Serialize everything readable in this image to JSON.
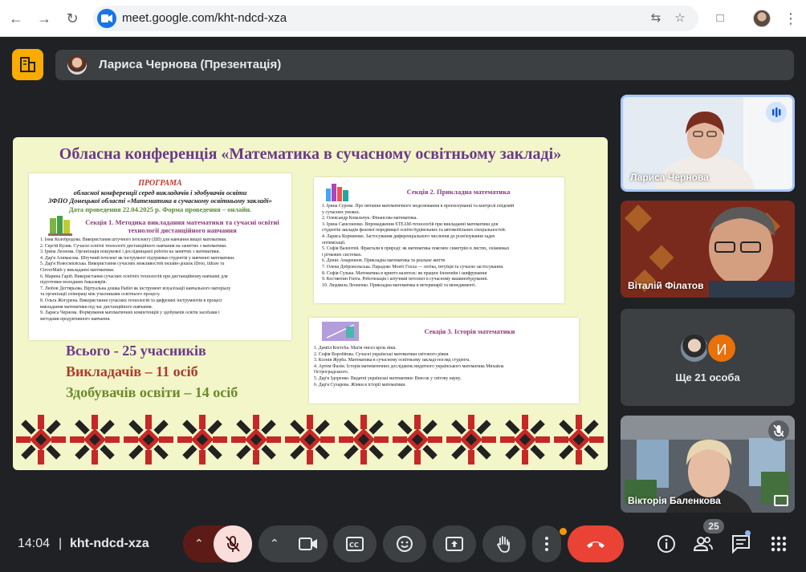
{
  "browser": {
    "url": "meet.google.com/kht-ndcd-xza"
  },
  "meet": {
    "presenter_label": "Лариса Чернова (Презентація)",
    "time": "14:04",
    "separator": "|",
    "meeting_code": "kht-ndcd-xza",
    "people_count": "25"
  },
  "slide": {
    "title": "Обласна конференція «Математика в сучасному освітньому закладі»",
    "program": {
      "heading": "ПРОГРАМА",
      "line1": "обласної конференції серед викладачів і здобувачів освіти",
      "line2": "ЗФПО Донецької області «Математика в сучасному освітньому закладі»",
      "date_line": "Дата проведення 22.04.2025 р. Форма проведення – онлайн.",
      "section_title": "Секція 1. Методика викладання математики та сучасні освітні технології дистанційного навчання",
      "items": [
        "1.  Інна Колобродова. Використання штучного інтелекту (ШІ) для навчання вищої математики.",
        "2.  Сергій Кулик. Сучасні освітні технології дистанційного навчання на заняттях з математики.",
        "3.  Ірина Леонова. Організація пошукової і дослідницької роботи на заняттях з математики.",
        "4.  Дар'я Алимасова. Штучний інтелект як інструмент підтримки студентів у вивченні математики.",
        "5.  Дар'я Новосмієвська. Використання сучасних можливостей онлайн-дошок iDroo, tldraw та",
        "     CleverMath у викладанні математики.",
        "6.  Марина Гаріб. Використання сучасних освітніх технологій при дистанційному навчанні для",
        "     підготовки молодших бакалаврів.",
        "7.  Любов Дегтярьова. Віртуальна дошка Padlet як інструмент візуалізації навчального матеріалу",
        "     та організації співпраці між учасниками освітнього процесу.",
        "8.  Ольга Жогурена. Використання сучасних технологій та цифрових інструментів в процесі",
        "     викладання математики під час дистанційного навчання.",
        "9.  Лариса Чернова. Формування математичних компетенцій у здобувачів освіти засобами і",
        "     методами продуктивного навчання."
      ]
    },
    "section2": {
      "title": "Секція 2. Прикладна математика",
      "items": [
        "1.  Ірина Сурова. Про питання математичного моделювання в прогнозуванні та контролі епідемій",
        "     у сучасних умовах.",
        "2.  Олександр Ковальчук. Фінансова математика.",
        "3.  Ірина Самсоненко. Впровадження STEAM-технологій при викладанні математики для",
        "     студентів закладів фахової передвищої освіти будівельних та автомобільних спеціальностей.",
        "4.  Лариса Корниенко. Застосування диференціального числення до розв'язування задач",
        "     оптимізації.",
        "5.  Софія Валентей. Фрактали в природі: як математика пояснює симетрію в листях, сніжинках",
        "     і річкових системах.",
        "6.  Денис Анареннов. Прикладна математика та реальне життя",
        "7.  Олена Добровольська. Парадокс Монті Голла — логіка, інтуїція та сучасне застосування.",
        "8.  Софія Сулька. Математика в крипто валютах: як працює блокчейн і шифрування",
        "9.  Костянтин Гонта. Роботизація і штучний інтелект в сучасному машинобудуванні.",
        "10. Людмила Леоненко. Прикладна математика в ветеринарії та менеджменті."
      ]
    },
    "section3": {
      "title": "Секція 3. Історія математики",
      "items": [
        "1.  Даміїл Коєтєба. Магія чисел крізь віки.",
        "2.  Софія Воробйова. Сучасні українські математики світового рівня.",
        "3.  Ксенія Журба. Математика в сучасному освітньому закладі-погляд студента.",
        "4.  Артем Фазім. Історія математичних досліджень видатного українського математика Михайла",
        "     Остроградського.",
        "5.  Дар'я Здоренко. Видатні українські математики: Внесок у світову науку.",
        "6.  Дар'я Сухарева. Жінки в історії математики."
      ]
    },
    "summary": {
      "total": "Всього - 25 учасників",
      "teachers": "Викладачів – 11 осіб",
      "students": "Здобувачів освіти – 14 осіб"
    }
  },
  "participants": {
    "tile1": "Лариса Чернова",
    "tile2": "Віталій Філатов",
    "more_initial": "И",
    "more_label": "Ще 21 особа",
    "tile4": "Вікторія Баленкова"
  },
  "colors": {
    "meet_bg": "#202124",
    "slide_bg": "#f3f6c8",
    "title_purple": "#6b3a8c",
    "accent_red": "#b03a2e",
    "accent_green": "#6a8b2e",
    "end_call": "#ea4335",
    "mic_muted": "#f9dedc"
  }
}
